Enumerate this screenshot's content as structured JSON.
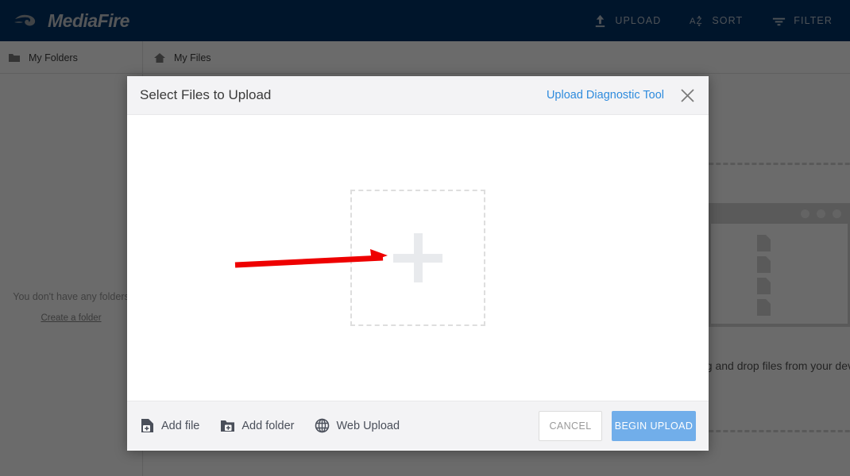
{
  "topbar": {
    "brand": "MediaFire",
    "brand_logo_icon": "mediafire-flame-logo",
    "nav": [
      {
        "label": "UPLOAD",
        "icon": "upload-arrow-icon"
      },
      {
        "label": "SORT",
        "icon": "sort-az-icon"
      },
      {
        "label": "FILTER",
        "icon": "filter-lines-icon"
      }
    ]
  },
  "subbar": {
    "folders_label": "My Folders",
    "folders_icon": "folder-icon",
    "files_label": "My Files",
    "files_icon": "home-icon"
  },
  "sidebar": {
    "empty_text": "You don't have any folders",
    "create_link": "Create a folder"
  },
  "content": {
    "dropzone_text": "Drag and drop files from your device.",
    "window_icon": "browser-window-illustration",
    "doc_icon": "document-icon"
  },
  "modal": {
    "title": "Select Files to Upload",
    "diagnostic_link": "Upload Diagnostic Tool",
    "close_icon": "close-x-icon",
    "plus_icon": "plus-icon",
    "footer": {
      "actions": [
        {
          "label": "Add file",
          "icon": "file-plus-icon"
        },
        {
          "label": "Add folder",
          "icon": "folder-plus-icon"
        },
        {
          "label": "Web Upload",
          "icon": "globe-icon"
        }
      ],
      "cancel_label": "CANCEL",
      "begin_label": "BEGIN UPLOAD"
    }
  },
  "annotation": {
    "arrow_icon": "red-arrow-pointer",
    "arrow_color": "#ee0000"
  },
  "colors": {
    "topbar_bg": "#003366",
    "primary_button": "#71aeea",
    "link_blue": "#2e8bdd",
    "modal_chrome": "#f3f3f5"
  }
}
